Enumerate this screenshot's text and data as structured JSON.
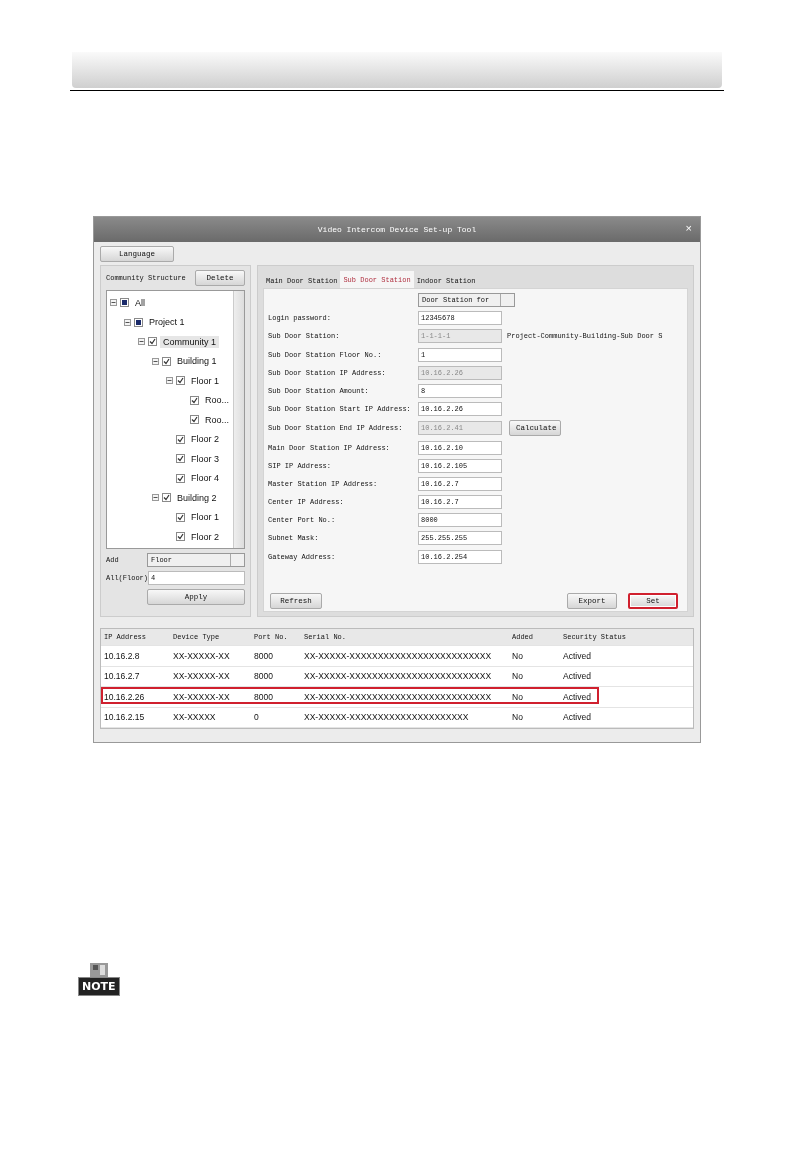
{
  "window": {
    "title": "Video Intercom Device Set-up Tool",
    "close": "×"
  },
  "language_button": "Language",
  "community": {
    "title": "Community Structure",
    "delete_button": "Delete",
    "tree": [
      {
        "label": "All",
        "checked": true,
        "partial": true,
        "selected": false,
        "expanded": true,
        "children": [
          {
            "label": "Project 1",
            "checked": true,
            "partial": true,
            "selected": false,
            "expanded": true,
            "children": [
              {
                "label": "Community 1",
                "checked": true,
                "partial": false,
                "selected": true,
                "expanded": true,
                "children": [
                  {
                    "label": "Building 1",
                    "checked": true,
                    "partial": false,
                    "selected": false,
                    "expanded": true,
                    "children": [
                      {
                        "label": "Floor 1",
                        "checked": true,
                        "partial": false,
                        "selected": false,
                        "expanded": true,
                        "children": [
                          {
                            "label": "Roo...",
                            "checked": true,
                            "partial": false,
                            "selected": false
                          },
                          {
                            "label": "Roo...",
                            "checked": true,
                            "partial": false,
                            "selected": false
                          }
                        ]
                      },
                      {
                        "label": "Floor 2",
                        "checked": true,
                        "partial": false,
                        "selected": false
                      },
                      {
                        "label": "Floor 3",
                        "checked": true,
                        "partial": false,
                        "selected": false
                      },
                      {
                        "label": "Floor 4",
                        "checked": true,
                        "partial": false,
                        "selected": false
                      }
                    ]
                  },
                  {
                    "label": "Building 2",
                    "checked": true,
                    "partial": false,
                    "selected": false,
                    "expanded": true,
                    "children": [
                      {
                        "label": "Floor 1",
                        "checked": true,
                        "partial": false,
                        "selected": false
                      },
                      {
                        "label": "Floor 2",
                        "checked": true,
                        "partial": false,
                        "selected": false
                      }
                    ]
                  }
                ]
              }
            ]
          }
        ]
      }
    ],
    "add_label": "Add",
    "add_value": "Floor",
    "all_label": "All(Floor)",
    "all_value": "4",
    "apply_button": "Apply"
  },
  "tabs": [
    {
      "label": "Main Door Station",
      "selected": false
    },
    {
      "label": "Sub Door Station",
      "selected": true
    },
    {
      "label": "Indoor Station",
      "selected": false
    }
  ],
  "device_select": "Door Station for",
  "fields": [
    {
      "label": "Login password:",
      "value": "12345678",
      "disabled": false
    },
    {
      "label": "Sub Door Station:",
      "value": "1-1-1-1",
      "disabled": true,
      "note": "Project-Community-Building-Sub Door S"
    },
    {
      "label": "Sub Door Station Floor No.:",
      "value": "1",
      "disabled": false
    },
    {
      "label": "Sub Door Station IP Address:",
      "value": "10.16.2.26",
      "disabled": true
    },
    {
      "label": "Sub Door Station Amount:",
      "value": "8",
      "disabled": false
    },
    {
      "label": "Sub Door Station Start IP Address:",
      "value": "10.16.2.26",
      "disabled": false
    },
    {
      "label": "Sub Door Station End IP Address:",
      "value": "10.16.2.41",
      "disabled": true,
      "button": "Calculate"
    },
    {
      "label": "Main Door Station IP Address:",
      "value": "10.16.2.10",
      "disabled": false
    },
    {
      "label": "SIP IP Address:",
      "value": "10.16.2.105",
      "disabled": false
    },
    {
      "label": "Master Station IP Address:",
      "value": "10.16.2.7",
      "disabled": false
    },
    {
      "label": "Center IP Address:",
      "value": "10.16.2.7",
      "disabled": false
    },
    {
      "label": "Center Port No.:",
      "value": "8000",
      "disabled": false
    },
    {
      "label": "Subnet Mask:",
      "value": "255.255.255",
      "disabled": false
    },
    {
      "label": "Gateway Address:",
      "value": "10.16.2.254",
      "disabled": false
    }
  ],
  "buttons": [
    {
      "label": "Refresh",
      "highlighted": false
    },
    {
      "label": "Export",
      "highlighted": false
    },
    {
      "label": "Set",
      "highlighted": true
    }
  ],
  "table": {
    "columns": [
      "IP Address",
      "Device Type",
      "Port No.",
      "Serial No.",
      "Added",
      "Security Status"
    ],
    "rows": [
      {
        "highlighted": false,
        "cells": [
          "10.16.2.8",
          "XX-XXXXX-XX",
          "8000",
          "XX-XXXXX-XXXXXXXXXXXXXXXXXXXXXXXXX",
          "No",
          "Actived"
        ]
      },
      {
        "highlighted": false,
        "cells": [
          "10.16.2.7",
          "XX-XXXXX-XX",
          "8000",
          "XX-XXXXX-XXXXXXXXXXXXXXXXXXXXXXXXX",
          "No",
          "Actived"
        ]
      },
      {
        "highlighted": true,
        "cells": [
          "10.16.2.26",
          "XX-XXXXX-XX",
          "8000",
          "XX-XXXXX-XXXXXXXXXXXXXXXXXXXXXXXXX",
          "No",
          "Actived"
        ]
      },
      {
        "highlighted": false,
        "cells": [
          "10.16.2.15",
          "XX-XXXXX",
          "0",
          "XX-XXXXX-XXXXXXXXXXXXXXXXXXXXX",
          "No",
          "Actived"
        ]
      }
    ]
  },
  "note_label": "NOTE"
}
